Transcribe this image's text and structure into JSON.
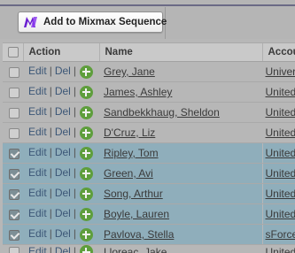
{
  "toolbar": {
    "mixmax_button_label": "Add to Mixmax Sequence",
    "logo_color": "#6b1fd1"
  },
  "table": {
    "headers": {
      "action": "Action",
      "name": "Name",
      "account": "Accou"
    },
    "action_labels": {
      "edit": "Edit",
      "del": "Del",
      "sep": "|"
    },
    "rows": [
      {
        "name": "Grey, Jane",
        "account": "Univer",
        "checked": false,
        "selected": false
      },
      {
        "name": "James, Ashley",
        "account": "United",
        "checked": false,
        "selected": false
      },
      {
        "name": "Sandbekkhaug, Sheldon",
        "account": "United",
        "checked": false,
        "selected": false
      },
      {
        "name": "D'Cruz, Liz",
        "account": "United",
        "checked": false,
        "selected": false
      },
      {
        "name": "Ripley, Tom",
        "account": "United",
        "checked": true,
        "selected": true
      },
      {
        "name": "Green, Avi",
        "account": "United",
        "checked": true,
        "selected": true
      },
      {
        "name": "Song, Arthur",
        "account": "United",
        "checked": true,
        "selected": true
      },
      {
        "name": "Boyle, Lauren",
        "account": "United",
        "checked": true,
        "selected": true
      },
      {
        "name": "Pavlova, Stella",
        "account": "sForce",
        "checked": true,
        "selected": true
      },
      {
        "name": "Lloreac, Jake",
        "account": "United",
        "checked": false,
        "selected": false
      }
    ],
    "selected_row_color": "#8faebb",
    "add_icon_color": "#5e9e3c"
  }
}
